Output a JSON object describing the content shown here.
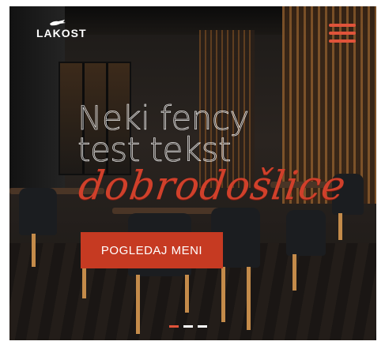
{
  "brand": {
    "name": "LAKOST",
    "logo_icon": "crocodile-icon"
  },
  "nav": {
    "menu_icon": "hamburger-menu-icon",
    "menu_color": "#e0533a"
  },
  "hero": {
    "headline_line1": "Neki fency",
    "headline_line2": "test tekst",
    "script_text": "dobrodošlice",
    "script_color": "#d0402b",
    "cta_label": "POGLEDAJ MENI",
    "cta_color": "#c63a22"
  },
  "slider": {
    "slides": 3,
    "active_index": 0,
    "active_color": "#e0533a"
  }
}
